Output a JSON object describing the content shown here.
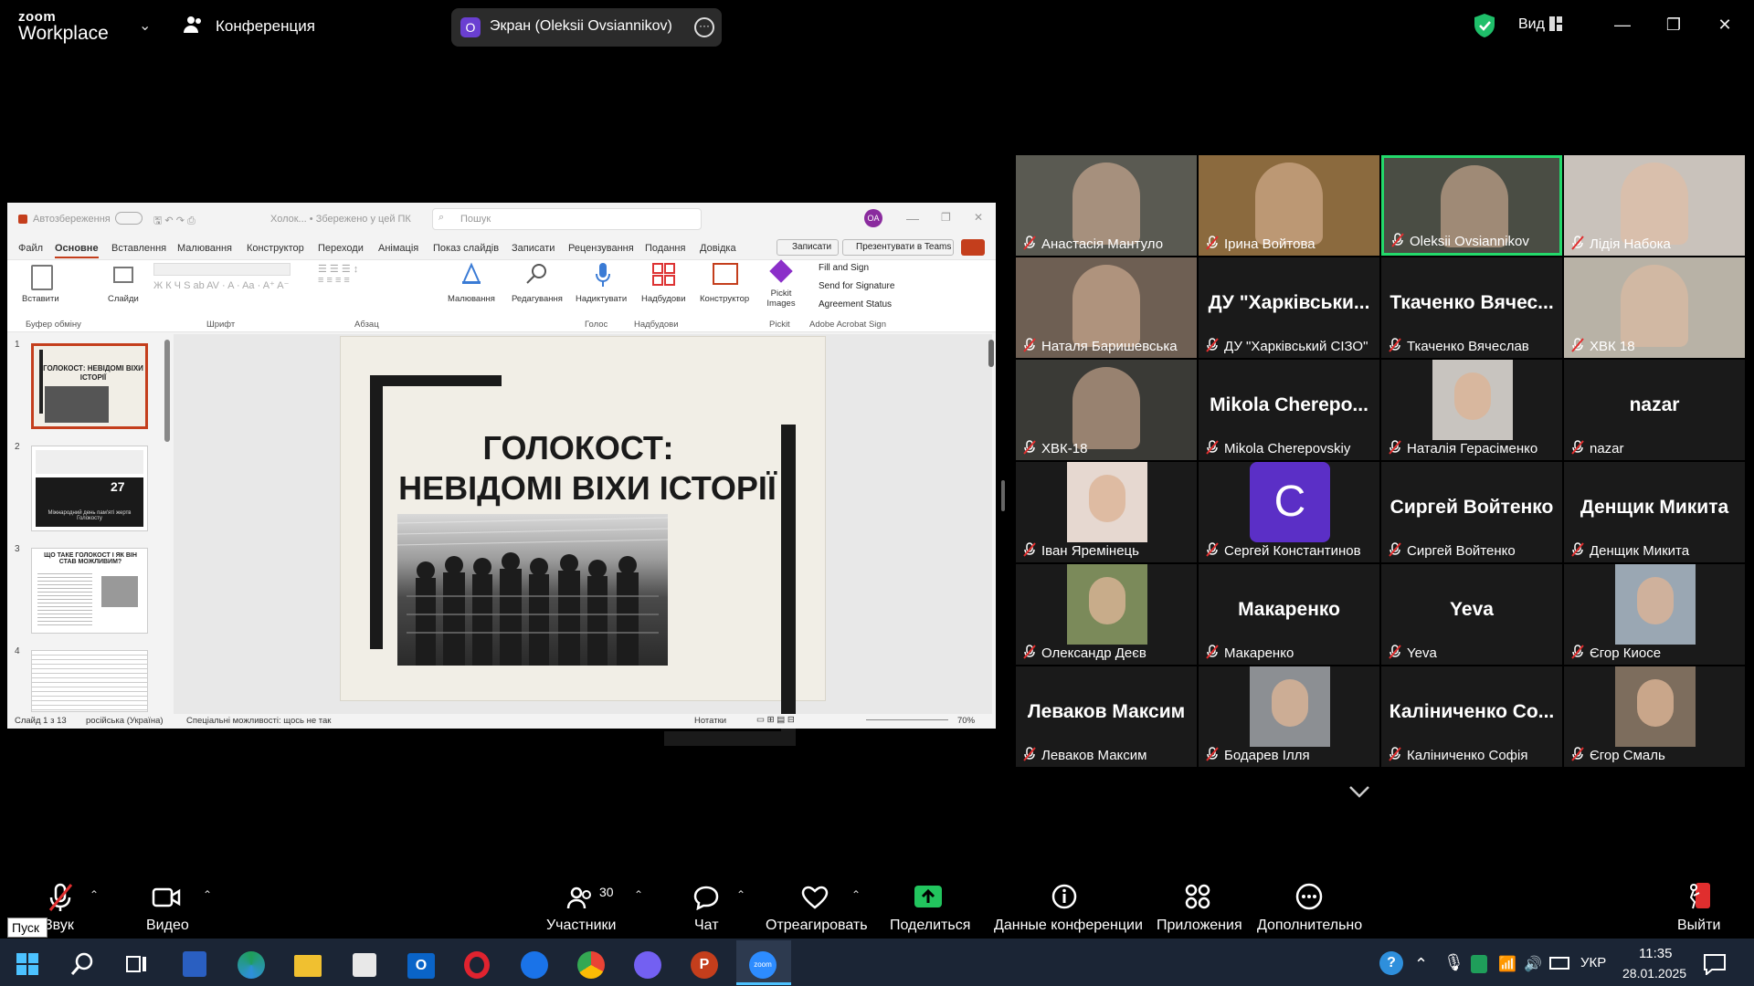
{
  "topbar": {
    "logo_line1": "zoom",
    "logo_line2": "Workplace",
    "conference_label": "Конференция",
    "screen_share_avatar": "O",
    "screen_share_label": "Экран (Oleksii Ovsiannikov)",
    "view_label": "Вид",
    "colors": {
      "shield": "#1fbf6a",
      "share_avatar": "#6a3fd1"
    }
  },
  "ppt": {
    "autosave_label": "Автозбереження",
    "title": "Холок... • Збережено у цей ПК",
    "search_placeholder": "Пошук",
    "user_initials": "OA",
    "menu": [
      "Файл",
      "Основне",
      "Вставлення",
      "Малювання",
      "Конструктор",
      "Переходи",
      "Анімація",
      "Показ слайдів",
      "Записати",
      "Рецензування",
      "Подання",
      "Довідка"
    ],
    "record_btn": "Записати",
    "teams_btn": "Презентувати в Teams",
    "ribbon": {
      "paste": "Вставити",
      "slides": "Слайди",
      "drawing": "Малювання",
      "editing": "Редагування",
      "dictate": "Надиктувати",
      "addins": "Надбудови",
      "designer": "Конструктор",
      "pickit": "Pickit Images",
      "fill_sign": "Fill and Sign",
      "send_sig": "Send for Signature",
      "agreement": "Agreement Status",
      "groups": [
        "Буфер обміну",
        "Шрифт",
        "Абзац",
        "Голос",
        "Надбудови",
        "Pickit",
        "Adobe Acrobat Sign"
      ]
    },
    "thumbnails": [
      {
        "num": "1",
        "text": "ГОЛОКОСТ: НЕВІДОМІ ВІХИ ІСТОРІЇ"
      },
      {
        "num": "2",
        "text": "Міжнародний день пам'яті жертв Голокосту",
        "badge": "27"
      },
      {
        "num": "3",
        "text": "ЩО ТАКЕ ГОЛОКОСТ І ЯК ВІН СТАВ МОЖЛИВИМ?"
      },
      {
        "num": "4",
        "text": ""
      }
    ],
    "slide": {
      "title_line1": "ГОЛОКОСТ:",
      "title_line2": "НЕВІДОМІ ВІХИ ІСТОРІЇ"
    },
    "status": {
      "slide_counter": "Слайд 1 з 13",
      "language": "російська (Україна)",
      "accessibility": "Спеціальні можливості: щось не так",
      "notes": "Нотатки",
      "zoom": "70%"
    }
  },
  "participants": [
    {
      "name": "Анастасія Мантуло",
      "video": true,
      "bg": "#5a5a52"
    },
    {
      "name": "Ірина Войтова",
      "video": true,
      "bg": "#8b6a3e"
    },
    {
      "name": "Oleksii Ovsiannikov",
      "video": true,
      "active": true,
      "bg": "#4a4d44"
    },
    {
      "name": "Лідія Набока",
      "video": true,
      "bg": "#c9c2bb"
    },
    {
      "name": "Наталя Баришевська",
      "video": true,
      "bg": "#6e5f53"
    },
    {
      "name": "ДУ \"Харківський СІЗО\"",
      "big": "ДУ \"Харківськи...",
      "video": false
    },
    {
      "name": "Ткаченко Вячеслав",
      "big": "Ткаченко Вячес...",
      "video": false
    },
    {
      "name": "ХВК 18",
      "video": true,
      "bg": "#b8b2a6"
    },
    {
      "name": "ХВК-18",
      "video": true,
      "bg": "#3a3a36"
    },
    {
      "name": "Mikola Cherepovskiy",
      "big": "Mikola Cherepo...",
      "video": false
    },
    {
      "name": "Наталія Герасіменко",
      "video": "photo",
      "bg": "#c8c4bf"
    },
    {
      "name": "nazar",
      "big": "nazar",
      "video": false
    },
    {
      "name": "Іван Яремінець",
      "video": "photo",
      "bg": "#e6d8d0"
    },
    {
      "name": "Сергей Константинов",
      "video": "avatar",
      "avatar_letter": "C",
      "avatar_color": "#5b2fc6"
    },
    {
      "name": "Сиргей Войтенко",
      "big": "Сиргей Войтенко",
      "video": false
    },
    {
      "name": "Денщик Микита",
      "big": "Денщик Микита",
      "video": false
    },
    {
      "name": "Олександр Деєв",
      "video": "photo",
      "bg": "#7b8a5a"
    },
    {
      "name": "Макаренко",
      "big": "Макаренко",
      "video": false
    },
    {
      "name": "Yeva",
      "big": "Yeva",
      "video": false
    },
    {
      "name": "Єгор Киосе",
      "video": "photo",
      "bg": "#9aa7b3"
    },
    {
      "name": "Леваков Максим",
      "big": "Леваков Максим",
      "video": false
    },
    {
      "name": "Бодарев Ілля",
      "video": "photo",
      "bg": "#8c8f93"
    },
    {
      "name": "Каліниченко Софія",
      "big": "Каліниченко Со...",
      "video": false
    },
    {
      "name": "Єгор Смаль",
      "video": "photo",
      "bg": "#7d6d5d"
    }
  ],
  "toolbar": {
    "audio": "Звук",
    "start_tooltip": "Пуск",
    "video": "Видео",
    "participants": "Участники",
    "participants_count": "30",
    "chat": "Чат",
    "react": "Отреагировать",
    "share": "Поделиться",
    "meeting_info": "Данные конференции",
    "apps": "Приложения",
    "more": "Дополнительно",
    "leave": "Выйти",
    "share_color": "#22c55e",
    "leave_color": "#e02e2e"
  },
  "taskbar": {
    "lang": "УКР",
    "time": "11:35",
    "date": "28.01.2025",
    "apps": [
      "start-icon",
      "search-icon",
      "task-view-icon",
      "files-icon",
      "edge-icon",
      "explorer-icon",
      "store-icon",
      "outlook-icon",
      "opera-icon",
      "teamviewer-icon",
      "chrome-icon",
      "viber-icon",
      "powerpoint-icon",
      "zoom-icon"
    ]
  }
}
